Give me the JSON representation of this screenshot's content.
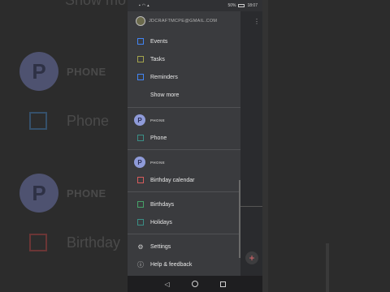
{
  "background": {
    "top_label": "Show mo",
    "rows": [
      {
        "type": "section",
        "avatar": "P",
        "label": "PHONE"
      },
      {
        "type": "check",
        "label": "Phone"
      },
      {
        "type": "section",
        "avatar": "P",
        "label": "PHONE"
      },
      {
        "type": "check",
        "label": "Birthday"
      }
    ]
  },
  "statusbar": {
    "battery": "50%",
    "time": "18:07"
  },
  "account": {
    "email": "JDCRAFTMCPE@GMAIL.COM"
  },
  "drawer": {
    "calendars": [
      {
        "label": "Events",
        "color": "#4285f4"
      },
      {
        "label": "Tasks",
        "color": "#a4a44c"
      },
      {
        "label": "Reminders",
        "color": "#4285f4"
      }
    ],
    "show_more": "Show more",
    "phone_section_1": {
      "avatar": "P",
      "title": "PHONE",
      "items": [
        {
          "label": "Phone",
          "color": "#3a8f86"
        }
      ]
    },
    "phone_section_2": {
      "avatar": "P",
      "title": "PHONE",
      "items": [
        {
          "label": "Birthday calendar",
          "color": "#d75c5c"
        }
      ]
    },
    "other": [
      {
        "label": "Birthdays",
        "color": "#46a369"
      },
      {
        "label": "Holidays",
        "color": "#3a8f86"
      }
    ],
    "settings": "Settings",
    "help": "Help & feedback"
  },
  "icons": {
    "settings": "gear-icon",
    "help": "help-icon",
    "back": "back-triangle-icon",
    "home": "home-circle-icon",
    "recents": "recents-square-icon"
  }
}
